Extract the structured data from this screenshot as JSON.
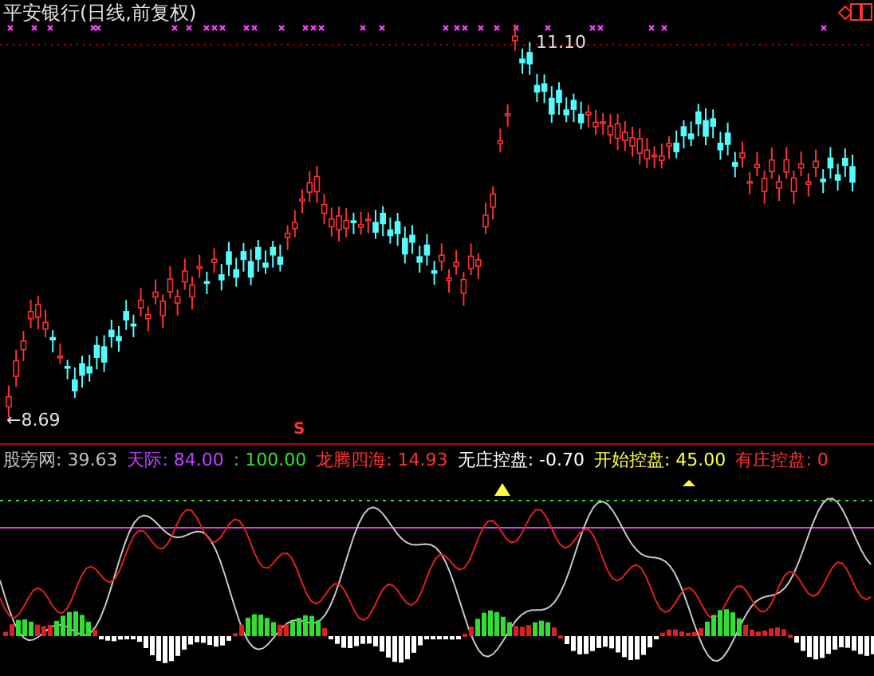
{
  "title": "平安银行(日线,前复权)",
  "high_label": "11.10",
  "low_label": "←8.69",
  "signal_mark": "S",
  "legend": [
    {
      "text": "股旁网: 39.63",
      "color": "#c0c0c0"
    },
    {
      "text": "天际: 84.00",
      "color": "#c040ff"
    },
    {
      "text": ": 100.00",
      "color": "#30e030"
    },
    {
      "text": "龙腾四海: 14.93",
      "color": "#ff3030"
    },
    {
      "text": "无庄控盘: -0.70",
      "color": "#ffffff"
    },
    {
      "text": "开始控盘: 45.00",
      "color": "#ffff40"
    },
    {
      "text": "有庄控盘: 0",
      "color": "#ff3030"
    }
  ]
}
